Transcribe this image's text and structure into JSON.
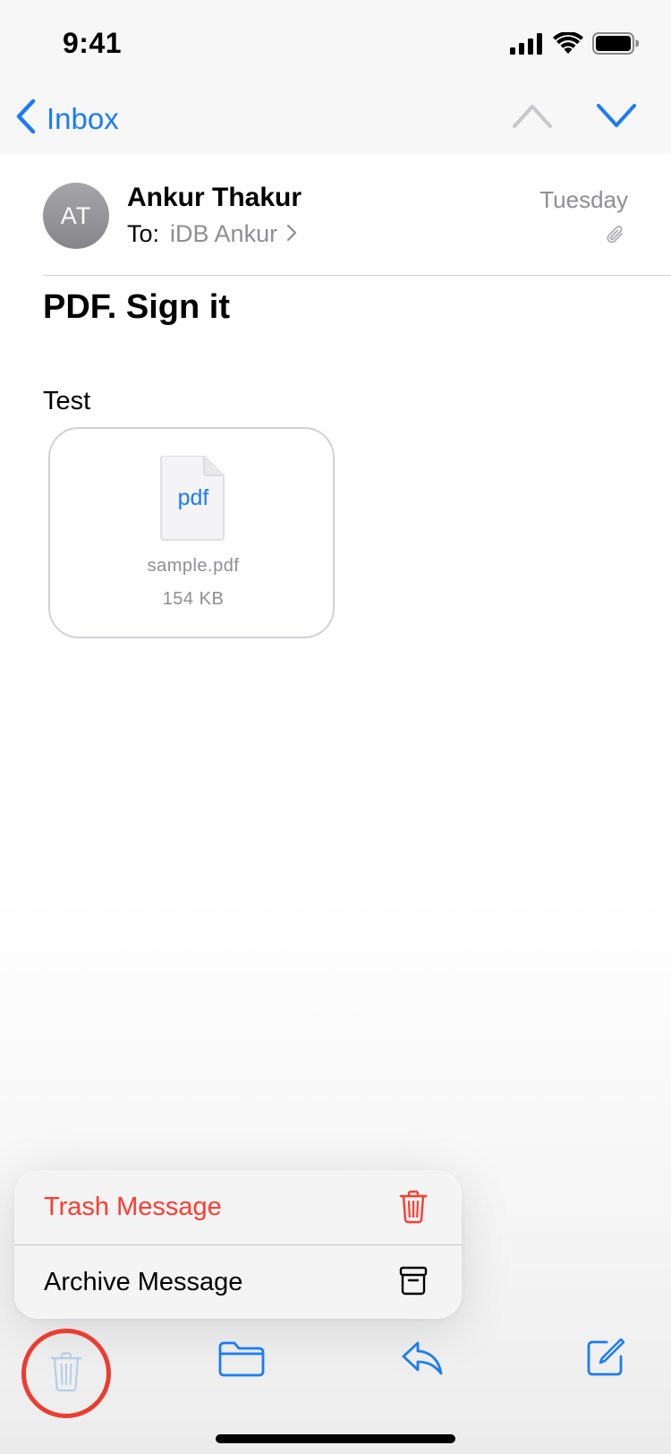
{
  "status_bar": {
    "time": "9:41",
    "icons": [
      "cellular-signal-icon",
      "wifi-icon",
      "battery-icon"
    ]
  },
  "nav": {
    "back_label": "Inbox",
    "icons": [
      "chevron-left-icon",
      "chevron-up-icon",
      "chevron-down-icon"
    ]
  },
  "message": {
    "avatar_initials": "AT",
    "sender": "Ankur Thakur",
    "to_label": "To:",
    "to_name": "iDB Ankur",
    "date": "Tuesday",
    "subject": "PDF. Sign it",
    "body": "Test",
    "attachment": {
      "type_label": "pdf",
      "name": "sample.pdf",
      "size": "154 KB"
    }
  },
  "menu": {
    "items": [
      {
        "label": "Trash Message",
        "icon": "trash-icon"
      },
      {
        "label": "Archive Message",
        "icon": "archive-box-icon"
      }
    ]
  },
  "toolbar": {
    "icons": [
      "trash-icon",
      "folder-icon",
      "reply-icon",
      "compose-icon"
    ]
  },
  "colors": {
    "accent": "#1a7cf5",
    "destructive": "#ff3b30",
    "secondary_text": "#8e8e93"
  }
}
